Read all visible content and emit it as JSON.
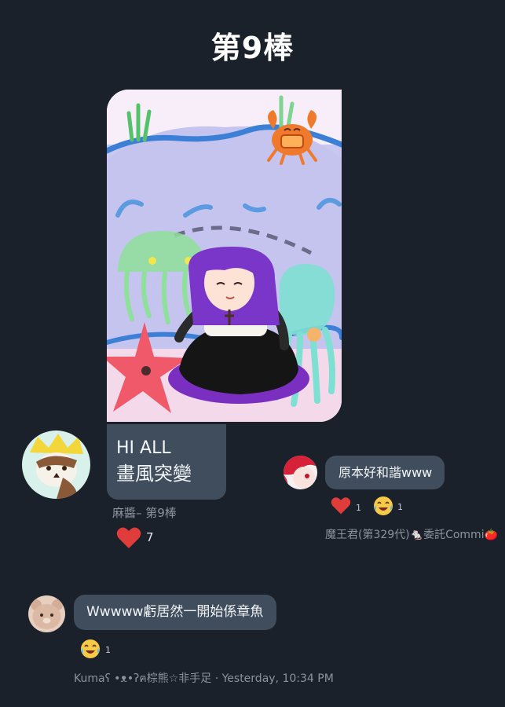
{
  "page_title": "第9棒",
  "post": {
    "image_alt": "painting",
    "message_line1": "HI ALL",
    "message_line2": "畫風突變",
    "author": "麻醬– 第9棒",
    "reaction_emoji": "❤",
    "reaction_count": "7"
  },
  "reply1": {
    "message": "原本好和諧www",
    "reactions": [
      {
        "emoji": "❤",
        "count": "1"
      },
      {
        "emoji": "😂",
        "count": "1"
      }
    ],
    "author": "魔王君(第329代)🐁委託Commi🍅"
  },
  "reply2": {
    "message": "Wwwww虧居然一開始係章魚",
    "reactions": [
      {
        "emoji": "😂",
        "count": "1"
      }
    ],
    "author": "Kumaʕ •ᴥ•ʔฅ棕熊☆非手足 · Yesterday, 10:34 PM"
  },
  "colors": {
    "background": "#1b212b",
    "bubble": "#3f4d5d",
    "heart": "#e03c3c"
  }
}
